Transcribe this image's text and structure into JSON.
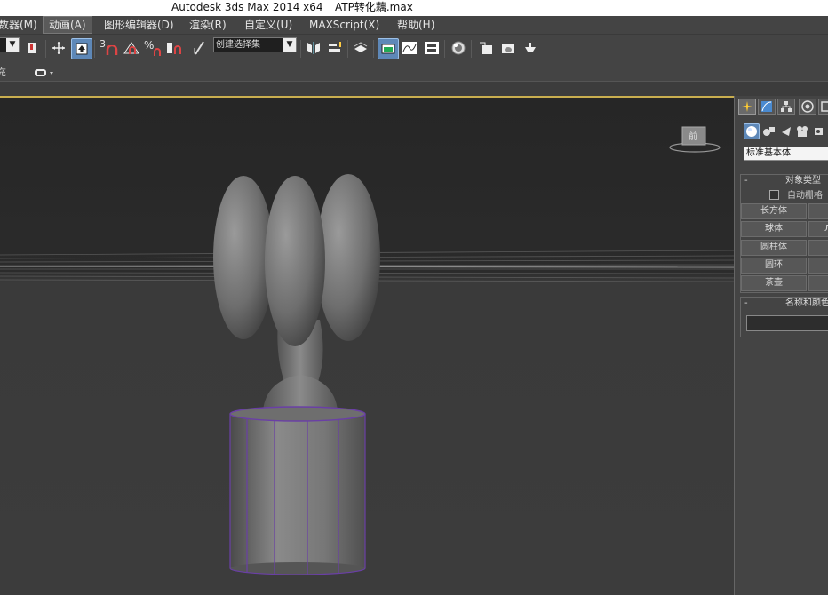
{
  "window": {
    "app_title": "Autodesk 3ds Max  2014 x64",
    "file_name": "ATP转化藕.max"
  },
  "menu": {
    "items": [
      {
        "label": "数器(M)"
      },
      {
        "label": "动画(A)"
      },
      {
        "label": "图形编辑器(D)"
      },
      {
        "label": "渲染(R)"
      },
      {
        "label": "自定义(U)"
      },
      {
        "label": "MAXScript(X)"
      },
      {
        "label": "帮助(H)"
      }
    ],
    "active_index": 1
  },
  "toolbar": {
    "snap_label": "3",
    "named_selection_value": "创建选择集",
    "icons": [
      "select-object-icon",
      "select-move-icon",
      "select-and-place-icon",
      "snap-toggle-icon",
      "angle-snap-icon",
      "percent-snap-icon",
      "spinner-snap-icon",
      "edit-named-selection-icon",
      "mirror-icon",
      "align-icon",
      "layer-manager-icon",
      "graphite-toggle-icon",
      "curve-editor-icon",
      "schematic-view-icon",
      "material-editor-icon",
      "render-setup-icon",
      "rendered-frame-icon",
      "render-production-icon"
    ]
  },
  "subbar": {
    "left_label": "充"
  },
  "viewport": {
    "viewcube_label": "前",
    "accent_color": "#c9ae4f",
    "selection_color": "#6a3fa6"
  },
  "command_panel": {
    "tabs": [
      "create-tab-icon",
      "modify-tab-icon",
      "hierarchy-tab-icon",
      "motion-tab-icon",
      "display-tab-icon"
    ],
    "categories": [
      "geometry-icon",
      "shapes-icon",
      "lights-icon",
      "cameras-icon",
      "helpers-icon"
    ],
    "category_dropdown": "标准基本体",
    "object_type": {
      "title": "对象类型",
      "autogrid_label": "自动栅格",
      "buttons": [
        "长方体",
        "球体",
        "圆柱体",
        "圆环",
        "茶壶"
      ],
      "right_partial": [
        "",
        "Л",
        "",
        "",
        ""
      ]
    },
    "name_color": {
      "title": "名称和颜色"
    }
  }
}
